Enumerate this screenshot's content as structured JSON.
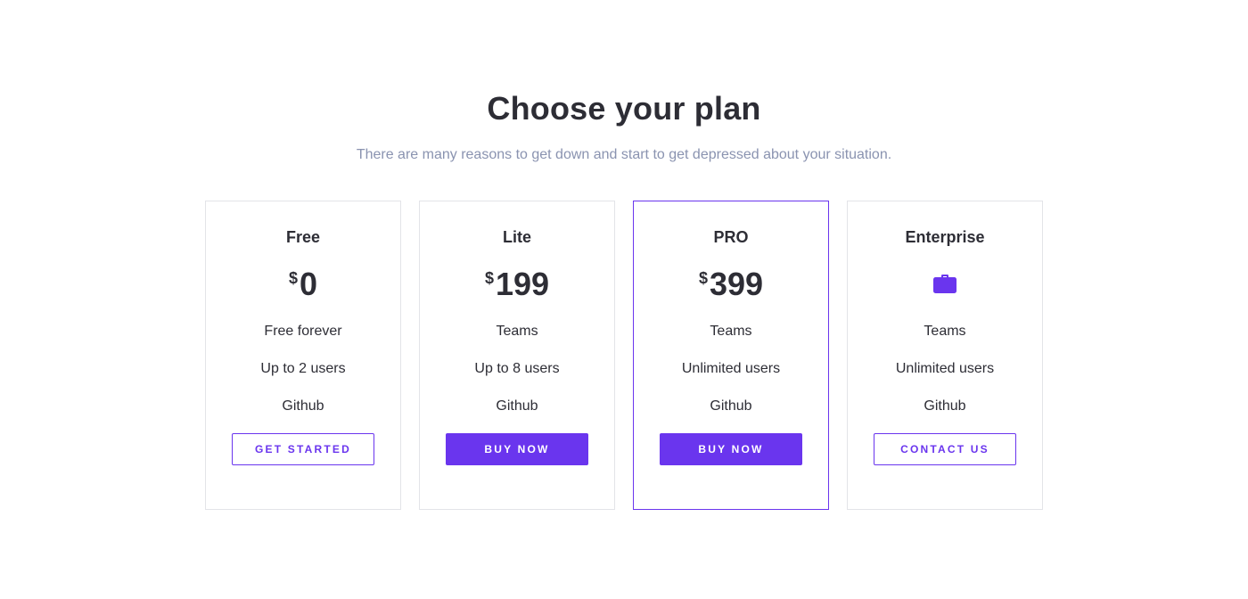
{
  "header": {
    "title": "Choose your plan",
    "subtitle": "There are many reasons to get down and start to get depressed about your situation."
  },
  "colors": {
    "accent": "#6a35ee",
    "text": "#2d2d35",
    "muted": "#8a93b0",
    "border": "#e3e4e8"
  },
  "plans": [
    {
      "name": "Free",
      "currency": "$",
      "price": "0",
      "features": [
        "Free forever",
        "Up to 2 users",
        "Github"
      ],
      "button_label": "GET STARTED",
      "button_style": "outline"
    },
    {
      "name": "Lite",
      "currency": "$",
      "price": "199",
      "features": [
        "Teams",
        "Up to 8 users",
        "Github"
      ],
      "button_label": "BUY NOW",
      "button_style": "solid"
    },
    {
      "name": "PRO",
      "currency": "$",
      "price": "399",
      "features": [
        "Teams",
        "Unlimited users",
        "Github"
      ],
      "button_label": "BUY NOW",
      "button_style": "solid",
      "featured": true
    },
    {
      "name": "Enterprise",
      "icon": "briefcase-icon",
      "features": [
        "Teams",
        "Unlimited users",
        "Github"
      ],
      "button_label": "CONTACT US",
      "button_style": "outline"
    }
  ]
}
